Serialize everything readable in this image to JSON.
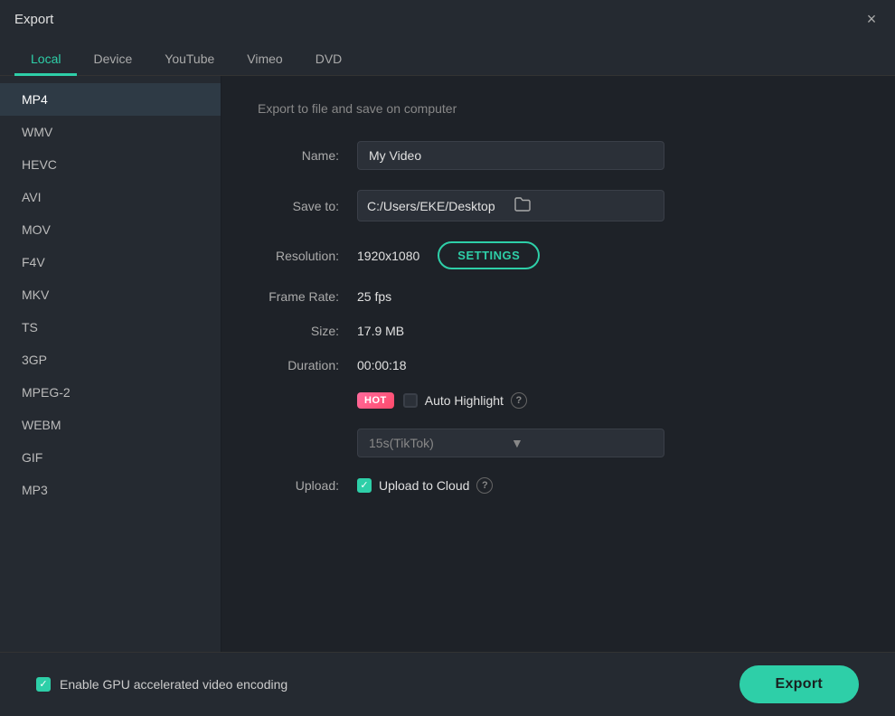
{
  "titlebar": {
    "title": "Export",
    "close_label": "×"
  },
  "tabs": [
    {
      "id": "local",
      "label": "Local",
      "active": true
    },
    {
      "id": "device",
      "label": "Device",
      "active": false
    },
    {
      "id": "youtube",
      "label": "YouTube",
      "active": false
    },
    {
      "id": "vimeo",
      "label": "Vimeo",
      "active": false
    },
    {
      "id": "dvd",
      "label": "DVD",
      "active": false
    }
  ],
  "sidebar": {
    "items": [
      {
        "id": "mp4",
        "label": "MP4",
        "active": true
      },
      {
        "id": "wmv",
        "label": "WMV",
        "active": false
      },
      {
        "id": "hevc",
        "label": "HEVC",
        "active": false
      },
      {
        "id": "avi",
        "label": "AVI",
        "active": false
      },
      {
        "id": "mov",
        "label": "MOV",
        "active": false
      },
      {
        "id": "f4v",
        "label": "F4V",
        "active": false
      },
      {
        "id": "mkv",
        "label": "MKV",
        "active": false
      },
      {
        "id": "ts",
        "label": "TS",
        "active": false
      },
      {
        "id": "3gp",
        "label": "3GP",
        "active": false
      },
      {
        "id": "mpeg2",
        "label": "MPEG-2",
        "active": false
      },
      {
        "id": "webm",
        "label": "WEBM",
        "active": false
      },
      {
        "id": "gif",
        "label": "GIF",
        "active": false
      },
      {
        "id": "mp3",
        "label": "MP3",
        "active": false
      }
    ]
  },
  "content": {
    "section_title": "Export to file and save on computer",
    "name_label": "Name:",
    "name_value": "My Video",
    "name_placeholder": "My Video",
    "save_to_label": "Save to:",
    "save_to_path": "C:/Users/EKE/Desktop",
    "resolution_label": "Resolution:",
    "resolution_value": "1920x1080",
    "settings_btn_label": "SETTINGS",
    "frame_rate_label": "Frame Rate:",
    "frame_rate_value": "25 fps",
    "size_label": "Size:",
    "size_value": "17.9 MB",
    "duration_label": "Duration:",
    "duration_value": "00:00:18",
    "hot_badge": "HOT",
    "auto_highlight_label": "Auto Highlight",
    "auto_highlight_checked": false,
    "dropdown_value": "15s(TikTok)",
    "upload_label": "Upload:",
    "upload_to_cloud_label": "Upload to Cloud",
    "upload_to_cloud_checked": true
  },
  "bottom": {
    "gpu_label": "Enable GPU accelerated video encoding",
    "gpu_checked": true,
    "export_btn_label": "Export"
  }
}
